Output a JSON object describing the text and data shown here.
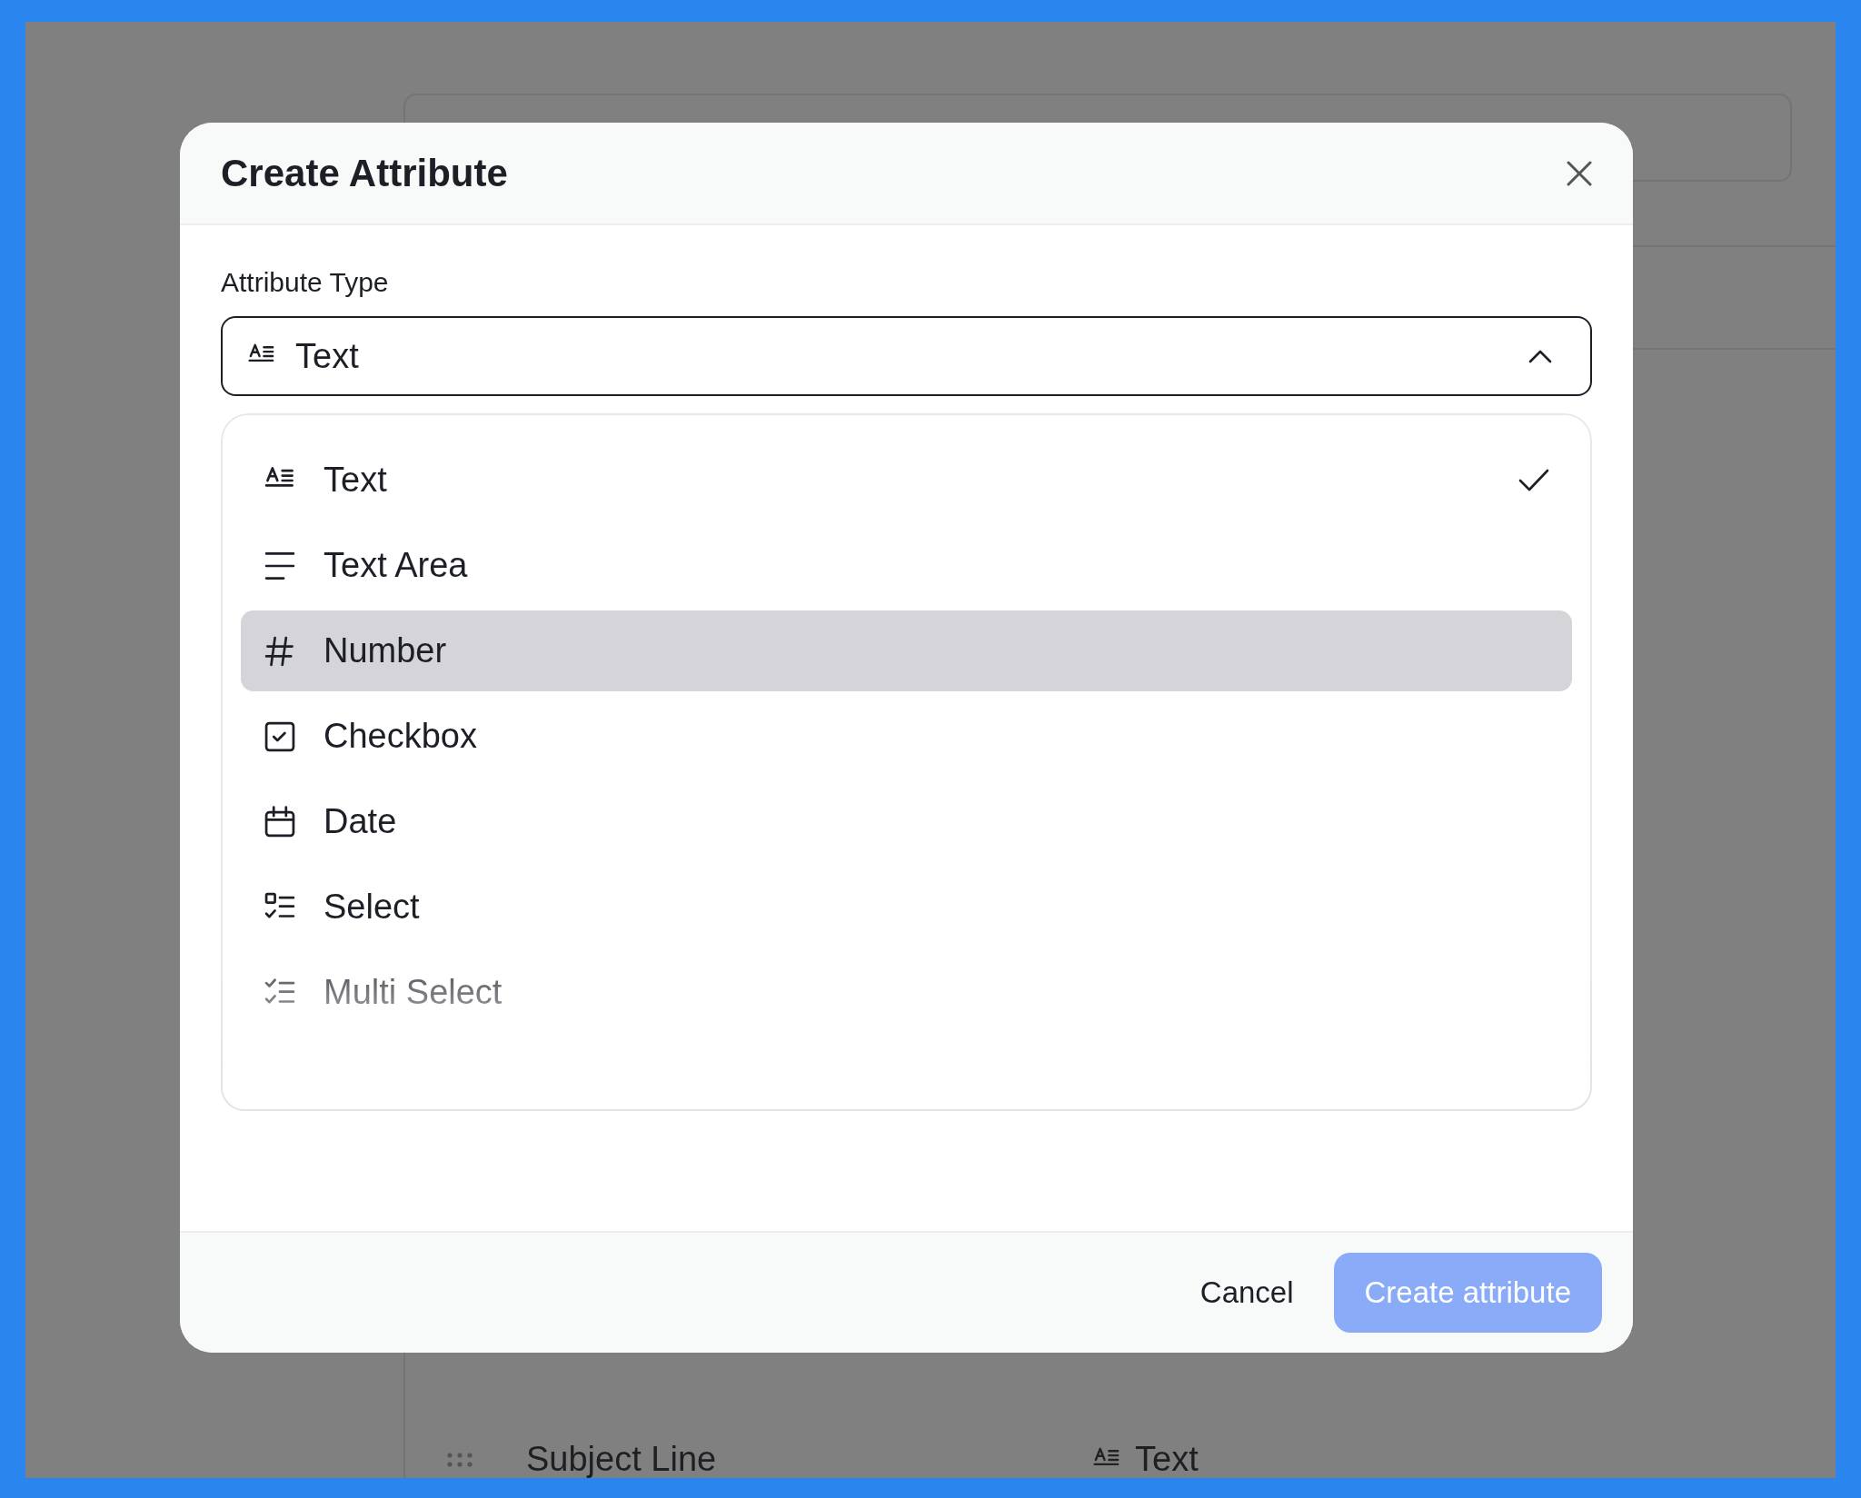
{
  "background": {
    "rows": [
      {
        "name": "Subject Line",
        "type": "Text",
        "kind": "text"
      }
    ]
  },
  "dialog": {
    "title": "Create Attribute",
    "field_label": "Attribute Type",
    "select": {
      "value": "Text",
      "kind": "text",
      "expanded": true
    },
    "options": [
      {
        "label": "Text",
        "kind": "text",
        "selected": true,
        "highlighted": false
      },
      {
        "label": "Text Area",
        "kind": "textarea",
        "selected": false,
        "highlighted": false
      },
      {
        "label": "Number",
        "kind": "number",
        "selected": false,
        "highlighted": true
      },
      {
        "label": "Checkbox",
        "kind": "checkbox",
        "selected": false,
        "highlighted": false
      },
      {
        "label": "Date",
        "kind": "date",
        "selected": false,
        "highlighted": false
      },
      {
        "label": "Select",
        "kind": "select",
        "selected": false,
        "highlighted": false
      },
      {
        "label": "Multi Select",
        "kind": "multiselect",
        "selected": false,
        "highlighted": false
      }
    ],
    "buttons": [
      {
        "label": "Cancel",
        "kind": "secondary",
        "disabled": false
      },
      {
        "label": "Create attribute",
        "kind": "primary",
        "disabled": true
      }
    ]
  }
}
